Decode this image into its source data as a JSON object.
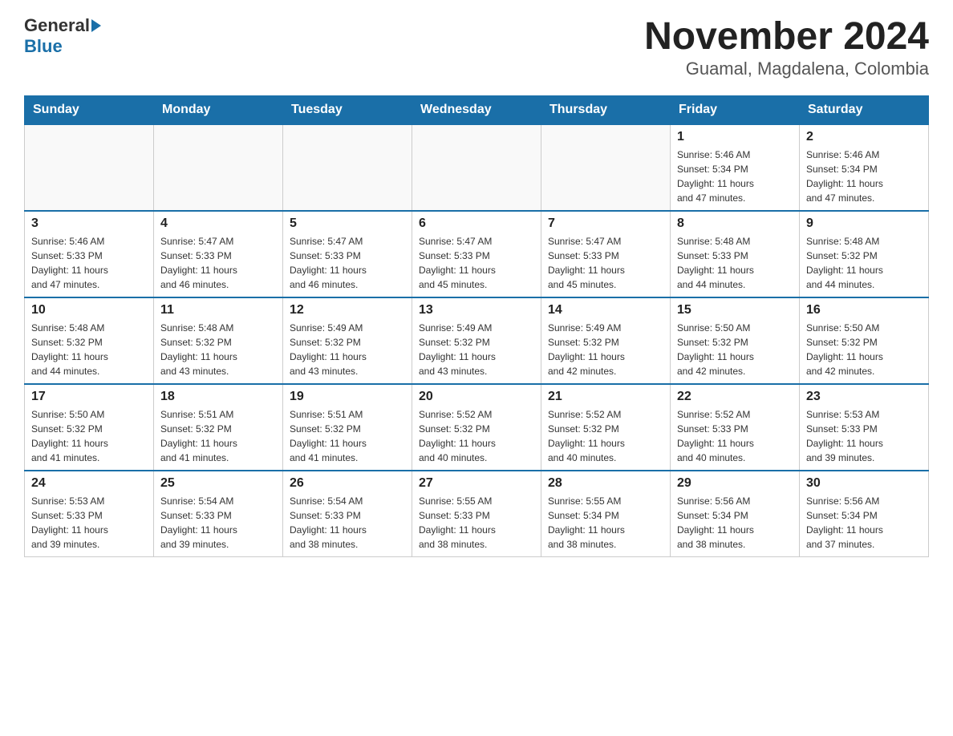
{
  "header": {
    "logo_line1": "General",
    "logo_line2": "Blue",
    "title": "November 2024",
    "subtitle": "Guamal, Magdalena, Colombia"
  },
  "days_of_week": [
    "Sunday",
    "Monday",
    "Tuesday",
    "Wednesday",
    "Thursday",
    "Friday",
    "Saturday"
  ],
  "weeks": [
    [
      {
        "day": "",
        "info": ""
      },
      {
        "day": "",
        "info": ""
      },
      {
        "day": "",
        "info": ""
      },
      {
        "day": "",
        "info": ""
      },
      {
        "day": "",
        "info": ""
      },
      {
        "day": "1",
        "info": "Sunrise: 5:46 AM\nSunset: 5:34 PM\nDaylight: 11 hours\nand 47 minutes."
      },
      {
        "day": "2",
        "info": "Sunrise: 5:46 AM\nSunset: 5:34 PM\nDaylight: 11 hours\nand 47 minutes."
      }
    ],
    [
      {
        "day": "3",
        "info": "Sunrise: 5:46 AM\nSunset: 5:33 PM\nDaylight: 11 hours\nand 47 minutes."
      },
      {
        "day": "4",
        "info": "Sunrise: 5:47 AM\nSunset: 5:33 PM\nDaylight: 11 hours\nand 46 minutes."
      },
      {
        "day": "5",
        "info": "Sunrise: 5:47 AM\nSunset: 5:33 PM\nDaylight: 11 hours\nand 46 minutes."
      },
      {
        "day": "6",
        "info": "Sunrise: 5:47 AM\nSunset: 5:33 PM\nDaylight: 11 hours\nand 45 minutes."
      },
      {
        "day": "7",
        "info": "Sunrise: 5:47 AM\nSunset: 5:33 PM\nDaylight: 11 hours\nand 45 minutes."
      },
      {
        "day": "8",
        "info": "Sunrise: 5:48 AM\nSunset: 5:33 PM\nDaylight: 11 hours\nand 44 minutes."
      },
      {
        "day": "9",
        "info": "Sunrise: 5:48 AM\nSunset: 5:32 PM\nDaylight: 11 hours\nand 44 minutes."
      }
    ],
    [
      {
        "day": "10",
        "info": "Sunrise: 5:48 AM\nSunset: 5:32 PM\nDaylight: 11 hours\nand 44 minutes."
      },
      {
        "day": "11",
        "info": "Sunrise: 5:48 AM\nSunset: 5:32 PM\nDaylight: 11 hours\nand 43 minutes."
      },
      {
        "day": "12",
        "info": "Sunrise: 5:49 AM\nSunset: 5:32 PM\nDaylight: 11 hours\nand 43 minutes."
      },
      {
        "day": "13",
        "info": "Sunrise: 5:49 AM\nSunset: 5:32 PM\nDaylight: 11 hours\nand 43 minutes."
      },
      {
        "day": "14",
        "info": "Sunrise: 5:49 AM\nSunset: 5:32 PM\nDaylight: 11 hours\nand 42 minutes."
      },
      {
        "day": "15",
        "info": "Sunrise: 5:50 AM\nSunset: 5:32 PM\nDaylight: 11 hours\nand 42 minutes."
      },
      {
        "day": "16",
        "info": "Sunrise: 5:50 AM\nSunset: 5:32 PM\nDaylight: 11 hours\nand 42 minutes."
      }
    ],
    [
      {
        "day": "17",
        "info": "Sunrise: 5:50 AM\nSunset: 5:32 PM\nDaylight: 11 hours\nand 41 minutes."
      },
      {
        "day": "18",
        "info": "Sunrise: 5:51 AM\nSunset: 5:32 PM\nDaylight: 11 hours\nand 41 minutes."
      },
      {
        "day": "19",
        "info": "Sunrise: 5:51 AM\nSunset: 5:32 PM\nDaylight: 11 hours\nand 41 minutes."
      },
      {
        "day": "20",
        "info": "Sunrise: 5:52 AM\nSunset: 5:32 PM\nDaylight: 11 hours\nand 40 minutes."
      },
      {
        "day": "21",
        "info": "Sunrise: 5:52 AM\nSunset: 5:32 PM\nDaylight: 11 hours\nand 40 minutes."
      },
      {
        "day": "22",
        "info": "Sunrise: 5:52 AM\nSunset: 5:33 PM\nDaylight: 11 hours\nand 40 minutes."
      },
      {
        "day": "23",
        "info": "Sunrise: 5:53 AM\nSunset: 5:33 PM\nDaylight: 11 hours\nand 39 minutes."
      }
    ],
    [
      {
        "day": "24",
        "info": "Sunrise: 5:53 AM\nSunset: 5:33 PM\nDaylight: 11 hours\nand 39 minutes."
      },
      {
        "day": "25",
        "info": "Sunrise: 5:54 AM\nSunset: 5:33 PM\nDaylight: 11 hours\nand 39 minutes."
      },
      {
        "day": "26",
        "info": "Sunrise: 5:54 AM\nSunset: 5:33 PM\nDaylight: 11 hours\nand 38 minutes."
      },
      {
        "day": "27",
        "info": "Sunrise: 5:55 AM\nSunset: 5:33 PM\nDaylight: 11 hours\nand 38 minutes."
      },
      {
        "day": "28",
        "info": "Sunrise: 5:55 AM\nSunset: 5:34 PM\nDaylight: 11 hours\nand 38 minutes."
      },
      {
        "day": "29",
        "info": "Sunrise: 5:56 AM\nSunset: 5:34 PM\nDaylight: 11 hours\nand 38 minutes."
      },
      {
        "day": "30",
        "info": "Sunrise: 5:56 AM\nSunset: 5:34 PM\nDaylight: 11 hours\nand 37 minutes."
      }
    ]
  ]
}
